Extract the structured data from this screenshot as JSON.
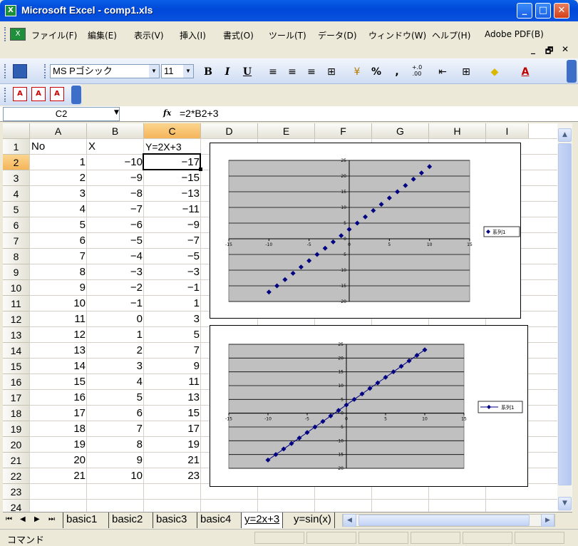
{
  "window": {
    "title": "Microsoft Excel - comp1.xls",
    "minimize": "_",
    "maximize": "□",
    "close": "✕"
  },
  "menu": {
    "items": [
      "ファイル(F)",
      "編集(E)",
      "表示(V)",
      "挿入(I)",
      "書式(O)",
      "ツール(T)",
      "データ(D)",
      "ウィンドウ(W)",
      "ヘルプ(H)",
      "Adobe PDF(B)"
    ],
    "doc_minimize": "_",
    "doc_restore": "🗗",
    "doc_close": "✕"
  },
  "toolbar": {
    "font_name": "MS Pゴシック",
    "font_size": "11",
    "bold": "B",
    "italic": "I",
    "underline": "U",
    "percent": "%",
    "comma": ",",
    "decimal": "+.0\n.00"
  },
  "formula_bar": {
    "name_box": "C2",
    "fx": "fx",
    "formula": "=2*B2+3"
  },
  "grid": {
    "columns": [
      "A",
      "B",
      "C",
      "D",
      "E",
      "F",
      "G",
      "H",
      "I"
    ],
    "rows": [
      "1",
      "2",
      "3",
      "4",
      "5",
      "6",
      "7",
      "8",
      "9",
      "10",
      "11",
      "12",
      "13",
      "14",
      "15",
      "16",
      "17",
      "18",
      "19",
      "20",
      "21",
      "22",
      "23",
      "24"
    ],
    "headers": {
      "a": "No",
      "b": "X",
      "c": "Y=2X+3"
    },
    "data": [
      [
        "1",
        "−10",
        "−17"
      ],
      [
        "2",
        "−9",
        "−15"
      ],
      [
        "3",
        "−8",
        "−13"
      ],
      [
        "4",
        "−7",
        "−11"
      ],
      [
        "5",
        "−6",
        "−9"
      ],
      [
        "6",
        "−5",
        "−7"
      ],
      [
        "7",
        "−4",
        "−5"
      ],
      [
        "8",
        "−3",
        "−3"
      ],
      [
        "9",
        "−2",
        "−1"
      ],
      [
        "10",
        "−1",
        "1"
      ],
      [
        "11",
        "0",
        "3"
      ],
      [
        "12",
        "1",
        "5"
      ],
      [
        "13",
        "2",
        "7"
      ],
      [
        "14",
        "3",
        "9"
      ],
      [
        "15",
        "4",
        "11"
      ],
      [
        "16",
        "5",
        "13"
      ],
      [
        "17",
        "6",
        "15"
      ],
      [
        "18",
        "7",
        "17"
      ],
      [
        "19",
        "8",
        "19"
      ],
      [
        "20",
        "9",
        "21"
      ],
      [
        "21",
        "10",
        "23"
      ]
    ],
    "active_cell": "C2"
  },
  "charts": [
    {
      "type": "scatter",
      "legend": "系列1",
      "legend_style": "marker",
      "x_ticks": [
        "-15",
        "-10",
        "-5",
        "0",
        "5",
        "10",
        "15"
      ],
      "y_ticks": [
        "25",
        "20",
        "15",
        "10",
        "5",
        "0",
        "-5",
        "-10",
        "-15",
        "-20"
      ],
      "xlim": [
        -15,
        15
      ],
      "ylim": [
        -20,
        25
      ],
      "x": [
        -10,
        -9,
        -8,
        -7,
        -6,
        -5,
        -4,
        -3,
        -2,
        -1,
        0,
        1,
        2,
        3,
        4,
        5,
        6,
        7,
        8,
        9,
        10
      ],
      "y": [
        -17,
        -15,
        -13,
        -11,
        -9,
        -7,
        -5,
        -3,
        -1,
        1,
        3,
        5,
        7,
        9,
        11,
        13,
        15,
        17,
        19,
        21,
        23
      ],
      "marker_color": "#000080"
    },
    {
      "type": "line",
      "legend": "系列1",
      "legend_style": "line-marker",
      "x_ticks": [
        "-15",
        "-10",
        "-5",
        "0",
        "5",
        "10",
        "15"
      ],
      "y_ticks": [
        "25",
        "20",
        "15",
        "10",
        "5",
        "0",
        "-5",
        "-10",
        "-15",
        "-20"
      ],
      "xlim": [
        -15,
        15
      ],
      "ylim": [
        -20,
        25
      ],
      "x": [
        -10,
        -9,
        -8,
        -7,
        -6,
        -5,
        -4,
        -3,
        -2,
        -1,
        0,
        1,
        2,
        3,
        4,
        5,
        6,
        7,
        8,
        9,
        10
      ],
      "y": [
        -17,
        -15,
        -13,
        -11,
        -9,
        -7,
        -5,
        -3,
        -1,
        1,
        3,
        5,
        7,
        9,
        11,
        13,
        15,
        17,
        19,
        21,
        23
      ],
      "marker_color": "#000080"
    }
  ],
  "sheets": {
    "tabs": [
      "basic1",
      "basic2",
      "basic3",
      "basic4",
      "y=2x+3",
      "y=sin(x)"
    ],
    "active": "y=2x+3"
  },
  "status": {
    "mode": "コマンド"
  },
  "colors": {
    "titlebar": "#0054e3",
    "plot_area": "#c0c0c0",
    "selected_header": "#f7c46c",
    "toolbar": "#dfe8f7"
  }
}
